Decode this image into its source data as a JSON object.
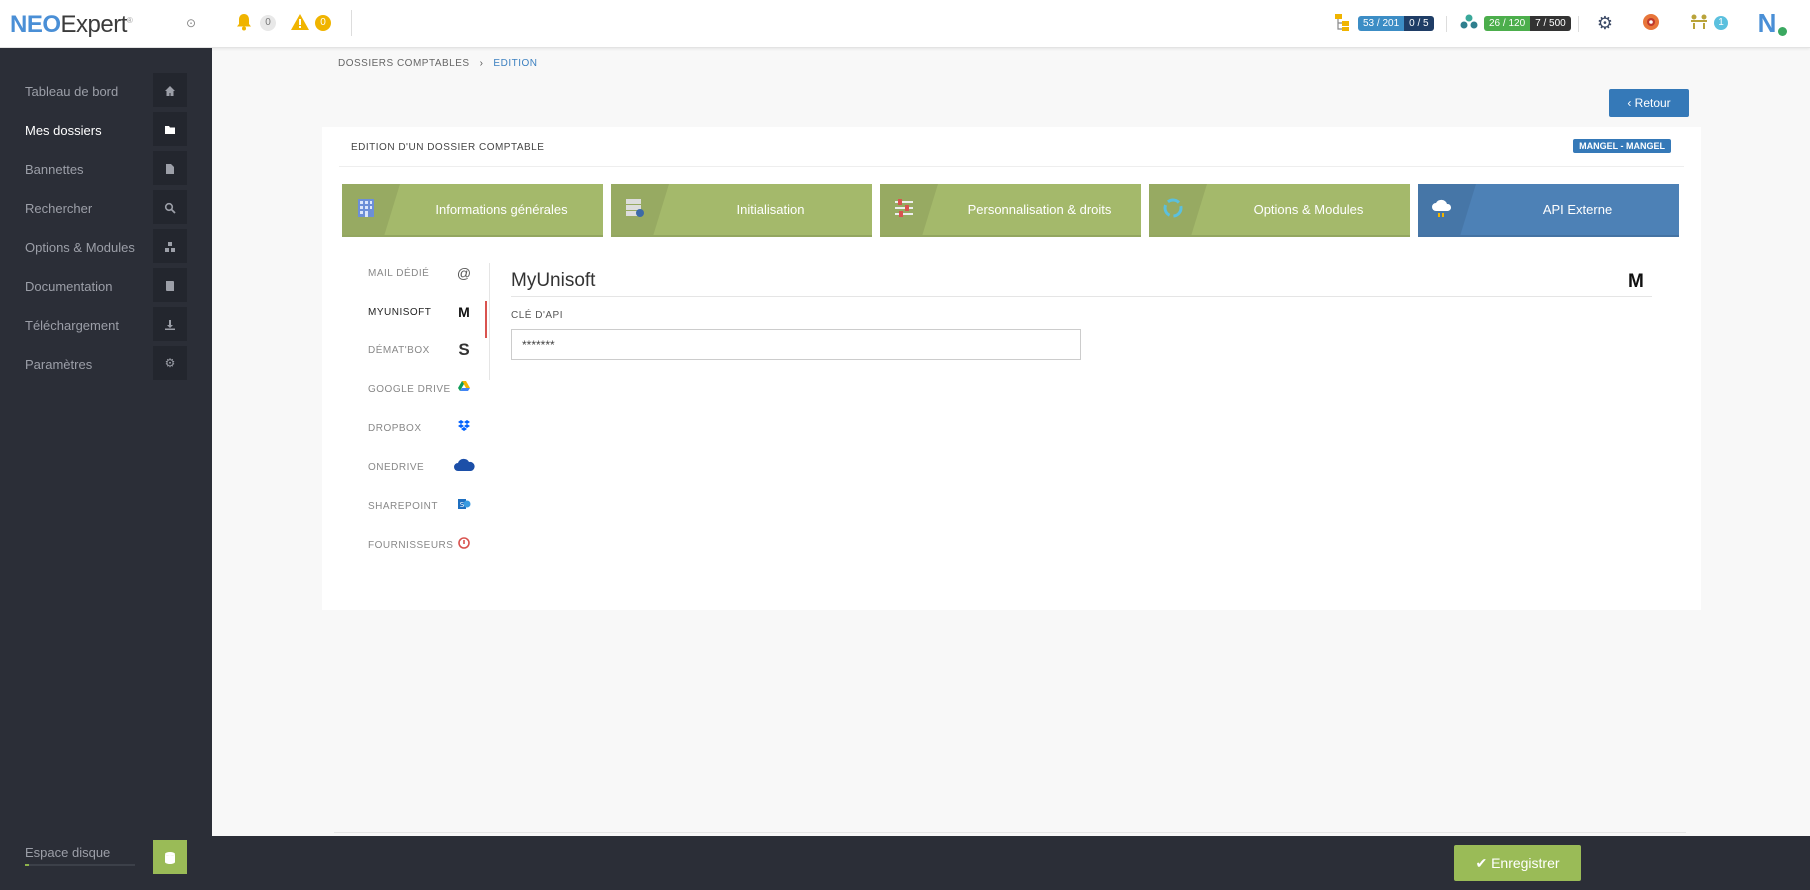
{
  "topbar": {
    "logo_neo": "NEO",
    "logo_expert": "Expert",
    "bell_count": "0",
    "warning_count": "0",
    "quota1_a": "53 / 201",
    "quota1_b": "0 / 5",
    "quota2_a": "26 / 120",
    "quota2_b": "7 / 500",
    "team_count": "1",
    "brand_initial": "N"
  },
  "sidebar": {
    "items": [
      {
        "label": "Tableau de bord",
        "icon": "home-icon"
      },
      {
        "label": "Mes dossiers",
        "icon": "folder-icon"
      },
      {
        "label": "Bannettes",
        "icon": "file-icon"
      },
      {
        "label": "Rechercher",
        "icon": "search-icon"
      },
      {
        "label": "Options & Modules",
        "icon": "modules-icon"
      },
      {
        "label": "Documentation",
        "icon": "book-icon"
      },
      {
        "label": "Téléchargement",
        "icon": "download-icon"
      },
      {
        "label": "Paramètres",
        "icon": "gears-icon"
      }
    ],
    "disk_label": "Espace disque"
  },
  "breadcrumb": {
    "root": "DOSSIERS COMPTABLES",
    "separator": "›",
    "current": "EDITION"
  },
  "back_button": "Retour",
  "panel": {
    "title": "EDITION D'UN DOSSIER COMPTABLE",
    "badge": "MANGEL - MANGEL"
  },
  "tabs": [
    {
      "label": "Informations générales",
      "icon": "building-icon"
    },
    {
      "label": "Initialisation",
      "icon": "server-icon"
    },
    {
      "label": "Personnalisation & droits",
      "icon": "sliders-icon"
    },
    {
      "label": "Options & Modules",
      "icon": "recycle-icon"
    },
    {
      "label": "API Externe",
      "icon": "cloud-icon"
    }
  ],
  "subnav": [
    {
      "label": "MAIL DÉDIÉ",
      "icon": "at-icon"
    },
    {
      "label": "MYUNISOFT",
      "icon": "myunisoft-icon"
    },
    {
      "label": "DÉMAT'BOX",
      "icon": "dematbox-icon"
    },
    {
      "label": "GOOGLE DRIVE",
      "icon": "google-drive-icon"
    },
    {
      "label": "DROPBOX",
      "icon": "dropbox-icon"
    },
    {
      "label": "ONEDRIVE",
      "icon": "onedrive-icon"
    },
    {
      "label": "SHAREPOINT",
      "icon": "sharepoint-icon"
    },
    {
      "label": "FOURNISSEURS",
      "icon": "fournisseurs-icon"
    }
  ],
  "content": {
    "title": "MyUnisoft",
    "logo_letter": "M",
    "field_label": "CLÉ D'API",
    "field_value": "*******"
  },
  "footer": {
    "save_label": "Enregistrer"
  },
  "colors": {
    "sidebar_bg": "#2b2e37",
    "tab_green": "#a4b96b",
    "tab_blue": "#4d81b6",
    "primary_blue": "#3579b8",
    "save_green": "#9abb57"
  }
}
